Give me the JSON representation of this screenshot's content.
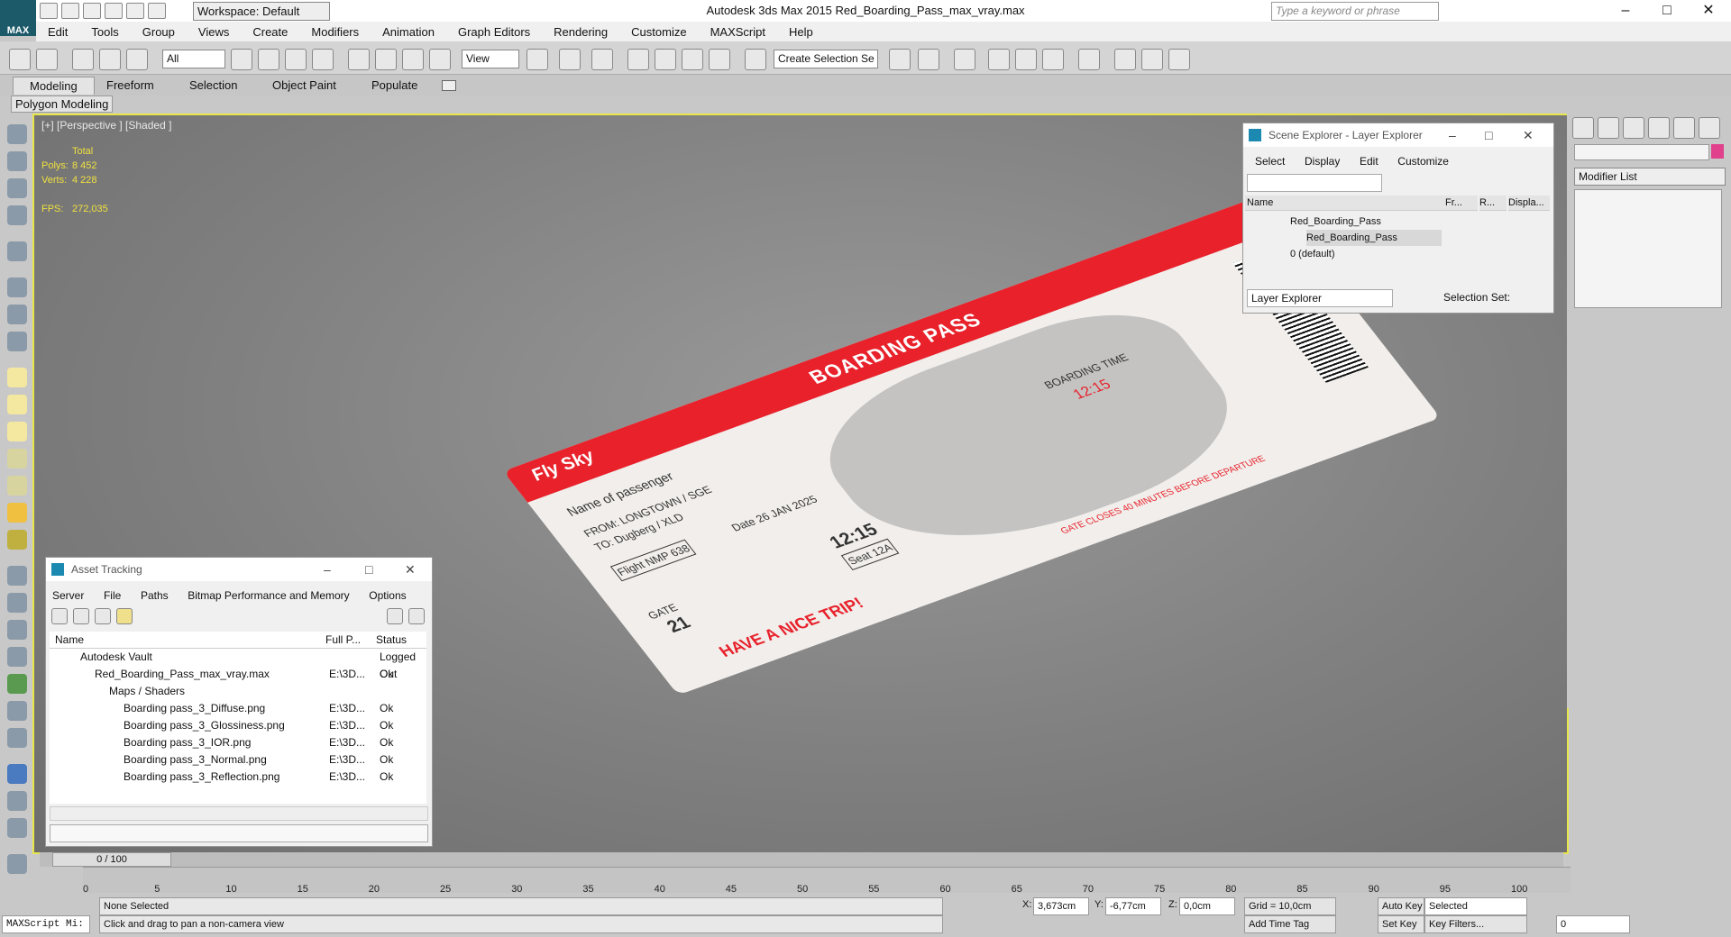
{
  "app": {
    "logo": "MAX",
    "window_title": "Autodesk 3ds Max  2015    Red_Boarding_Pass_max_vray.max",
    "workspace": "Workspace: Default",
    "search_placeholder": "Type a keyword or phrase"
  },
  "menu": [
    "Edit",
    "Tools",
    "Group",
    "Views",
    "Create",
    "Modifiers",
    "Animation",
    "Graph Editors",
    "Rendering",
    "Customize",
    "MAXScript",
    "Help"
  ],
  "toolbar": {
    "filter": "All",
    "ref_coord": "View",
    "selection_set": "Create Selection Se"
  },
  "ribbon": {
    "tabs": [
      "Modeling",
      "Freeform",
      "Selection",
      "Object Paint",
      "Populate"
    ],
    "panel": "Polygon Modeling"
  },
  "viewport": {
    "label": "[+] [Perspective ] [Shaded ]",
    "stats": {
      "total": "Total",
      "polys_label": "Polys:",
      "polys": "8 452",
      "verts_label": "Verts:",
      "verts": "4 228",
      "fps_label": "FPS:",
      "fps": "272,035"
    }
  },
  "pass": {
    "title": "BOARDING PASS",
    "brand": "Fly Sky",
    "name": "Name of passenger",
    "from": "FROM: LONGTOWN / SGE",
    "to": "TO: Dugberg / XLD",
    "date": "Date 26 JAN 2025",
    "flight": "Flight NMP 638",
    "boarding": "BOARDING TIME",
    "time": "12:15",
    "gate": "GATE",
    "gate_no": "21",
    "seat": "Seat 12A",
    "nice": "HAVE A NICE TRIP!",
    "closes": "GATE CLOSES 40 MINUTES BEFORE DEPARTURE"
  },
  "scene_explorer": {
    "title": "Scene Explorer - Layer Explorer",
    "menu": [
      "Select",
      "Display",
      "Edit",
      "Customize"
    ],
    "cols": [
      "Name",
      "Fr...",
      "R...",
      "Displa..."
    ],
    "rows": [
      {
        "name": "Red_Boarding_Pass"
      },
      {
        "name": "Red_Boarding_Pass"
      },
      {
        "name": "0 (default)"
      }
    ],
    "footer_select": "Layer Explorer",
    "footer_label": "Selection Set:"
  },
  "command_panel": {
    "modifier_list": "Modifier List"
  },
  "asset": {
    "title": "Asset Tracking",
    "menu": [
      "Server",
      "File",
      "Paths",
      "Bitmap Performance and Memory",
      "Options"
    ],
    "cols": [
      "Name",
      "Full P...",
      "Status"
    ],
    "rows": [
      {
        "name": "Autodesk Vault",
        "path": "",
        "status": "Logged Out"
      },
      {
        "name": "Red_Boarding_Pass_max_vray.max",
        "path": "E:\\3D...",
        "status": "Ok"
      },
      {
        "name": "Maps / Shaders",
        "path": "",
        "status": ""
      },
      {
        "name": "Boarding pass_3_Diffuse.png",
        "path": "E:\\3D...",
        "status": "Ok"
      },
      {
        "name": "Boarding pass_3_Glossiness.png",
        "path": "E:\\3D...",
        "status": "Ok"
      },
      {
        "name": "Boarding pass_3_IOR.png",
        "path": "E:\\3D...",
        "status": "Ok"
      },
      {
        "name": "Boarding pass_3_Normal.png",
        "path": "E:\\3D...",
        "status": "Ok"
      },
      {
        "name": "Boarding pass_3_Reflection.png",
        "path": "E:\\3D...",
        "status": "Ok"
      }
    ]
  },
  "timeline": {
    "slider": "0 / 100",
    "ticks": [
      "0",
      "5",
      "10",
      "15",
      "20",
      "25",
      "30",
      "35",
      "40",
      "45",
      "50",
      "55",
      "60",
      "65",
      "70",
      "75",
      "80",
      "85",
      "90",
      "95",
      "100"
    ]
  },
  "status": {
    "maxscript": "MAXScript Mi:",
    "selection": "None Selected",
    "prompt": "Click and drag to pan a non-camera view",
    "x_label": "X:",
    "x": "3,673cm",
    "y_label": "Y:",
    "y": "-6,77cm",
    "z_label": "Z:",
    "z": "0,0cm",
    "grid": "Grid = 10,0cm",
    "add_time_tag": "Add Time Tag",
    "auto_key": "Auto Key",
    "set_key": "Set Key",
    "key_mode": "Selected",
    "key_filters": "Key Filters...",
    "frame": "0"
  }
}
